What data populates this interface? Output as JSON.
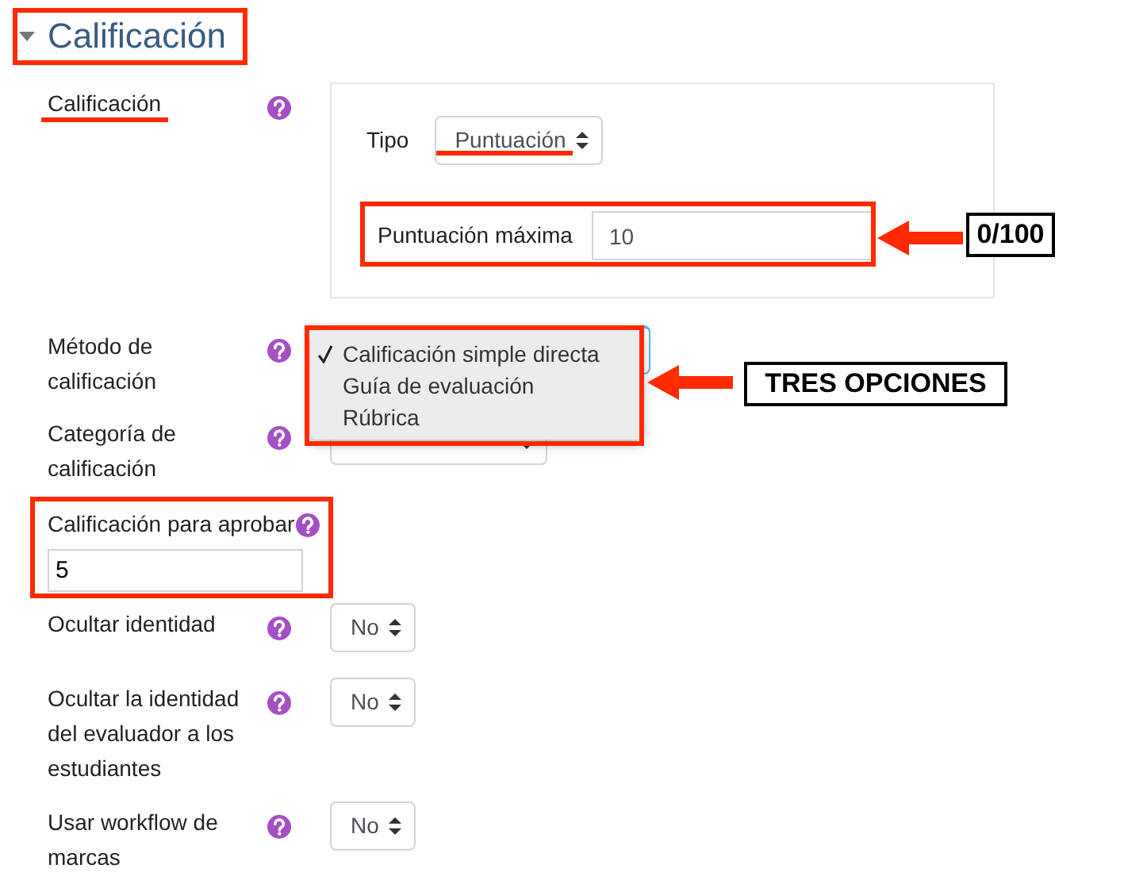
{
  "section": {
    "title": "Calificación",
    "expanded": true
  },
  "fields": [
    {
      "kind": "grade",
      "label": "Calificación",
      "type_label": "Tipo",
      "type_value": "Puntuación",
      "max_label": "Puntuación máxima",
      "max_value": "10"
    },
    {
      "kind": "menu",
      "label": "Método de calificación",
      "options": [
        {
          "label": "Calificación simple directa",
          "selected": true
        },
        {
          "label": "Guía de evaluación",
          "selected": false
        },
        {
          "label": "Rúbrica",
          "selected": false
        }
      ]
    },
    {
      "kind": "select",
      "label": "Categoría de calificación"
    },
    {
      "kind": "text",
      "label": "Calificación para aprobar",
      "value": "5"
    },
    {
      "kind": "select",
      "label": "Ocultar identidad",
      "value": "No"
    },
    {
      "kind": "select",
      "label": "Ocultar la identidad del evaluador a los estudiantes",
      "value": "No"
    },
    {
      "kind": "select",
      "label": "Usar workflow de marcas",
      "value": "No"
    }
  ],
  "callouts": [
    {
      "text": "0/100"
    },
    {
      "text": "TRES OPCIONES"
    }
  ]
}
